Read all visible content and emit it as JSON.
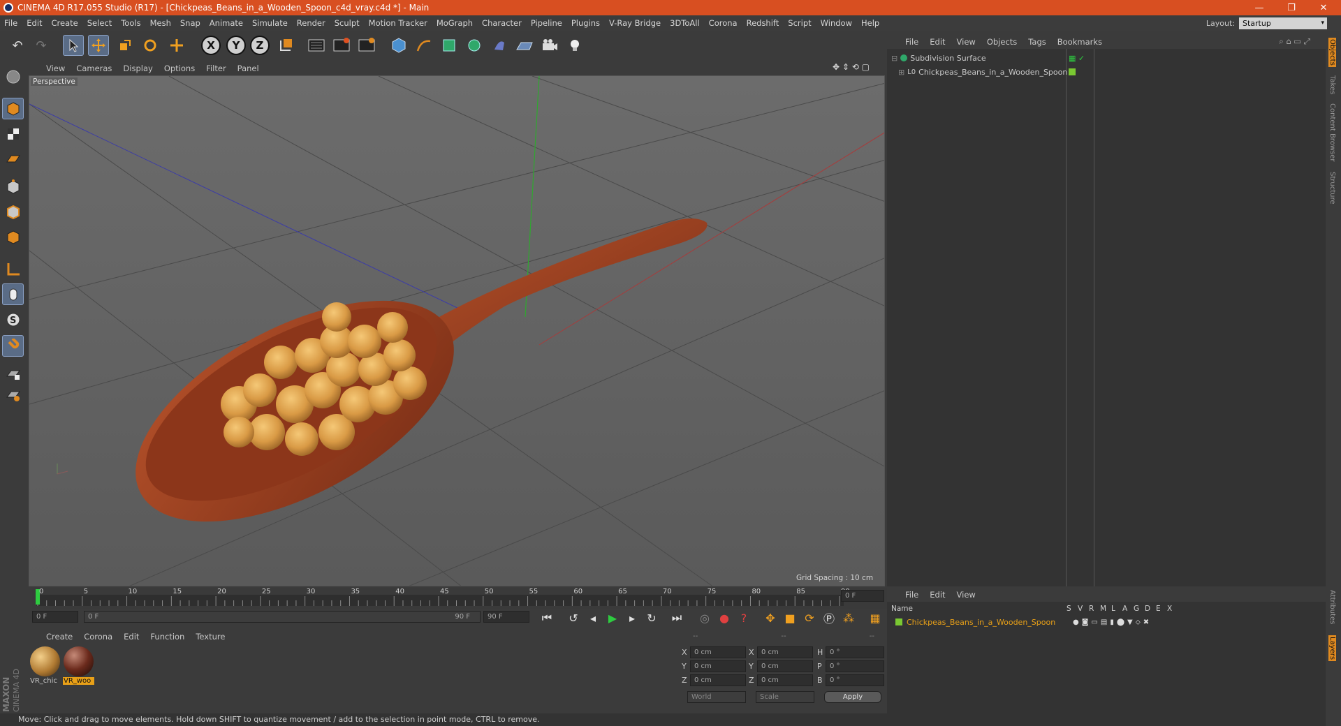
{
  "titlebar": {
    "title": "CINEMA 4D R17.055 Studio (R17) - [Chickpeas_Beans_in_a_Wooden_Spoon_c4d_vray.c4d *] - Main",
    "minimize": "—",
    "restore": "❐",
    "close": "✕"
  },
  "menu": [
    "File",
    "Edit",
    "Create",
    "Select",
    "Tools",
    "Mesh",
    "Snap",
    "Animate",
    "Simulate",
    "Render",
    "Sculpt",
    "Motion Tracker",
    "MoGraph",
    "Character",
    "Pipeline",
    "Plugins",
    "V-Ray Bridge",
    "3DToAll",
    "Corona",
    "Redshift",
    "Script",
    "Window",
    "Help"
  ],
  "layout": {
    "label": "Layout:",
    "value": "Startup"
  },
  "axes": {
    "x": "X",
    "y": "Y",
    "z": "Z"
  },
  "viewport": {
    "menu": [
      "View",
      "Cameras",
      "Display",
      "Options",
      "Filter",
      "Panel"
    ],
    "label": "Perspective",
    "grid_spacing": "Grid Spacing : 10 cm"
  },
  "timeline": {
    "ticks": [
      "0",
      "5",
      "10",
      "15",
      "20",
      "25",
      "30",
      "35",
      "40",
      "45",
      "50",
      "55",
      "60",
      "65",
      "70",
      "75",
      "80",
      "85",
      "90"
    ],
    "current_frame": "0 F",
    "start": "0 F",
    "range_start": "0 F",
    "range_end": "90 F",
    "end": "90 F"
  },
  "materials": {
    "menu": [
      "Create",
      "Corona",
      "Edit",
      "Function",
      "Texture"
    ],
    "items": [
      {
        "label": "VR_chic",
        "color": "#c08a3c"
      },
      {
        "label": "VR_woo",
        "color": "#6b2a1c"
      }
    ]
  },
  "coords": {
    "header": [
      "--",
      "--",
      "--"
    ],
    "rows": [
      {
        "a": "X",
        "av": "0 cm",
        "b": "X",
        "bv": "0 cm",
        "c": "H",
        "cv": "0 °"
      },
      {
        "a": "Y",
        "av": "0 cm",
        "b": "Y",
        "bv": "0 cm",
        "c": "P",
        "cv": "0 °"
      },
      {
        "a": "Z",
        "av": "0 cm",
        "b": "Z",
        "bv": "0 cm",
        "c": "B",
        "cv": "0 °"
      }
    ],
    "world": "World",
    "scale": "Scale",
    "apply": "Apply"
  },
  "status": "Move: Click and drag to move elements. Hold down SHIFT to quantize movement / add to the selection in point mode, CTRL to remove.",
  "objects": {
    "menu": [
      "File",
      "Edit",
      "View",
      "Objects",
      "Tags",
      "Bookmarks"
    ],
    "items": [
      {
        "name": "Subdivision Surface"
      },
      {
        "name": "Chickpeas_Beans_in_a_Wooden_Spoon"
      }
    ]
  },
  "layers": {
    "menu": [
      "File",
      "Edit",
      "View"
    ],
    "name_header": "Name",
    "cols": [
      "S",
      "V",
      "R",
      "M",
      "L",
      "A",
      "G",
      "D",
      "E",
      "X"
    ],
    "item": "Chickpeas_Beans_in_a_Wooden_Spoon",
    "item_color": "#e8a018"
  },
  "side_tabs": [
    "Objects",
    "Takes",
    "Content Browser",
    "Structure",
    "Attributes",
    "Layers"
  ],
  "brand": {
    "line1": "MAXON",
    "line2": "CINEMA 4D"
  }
}
